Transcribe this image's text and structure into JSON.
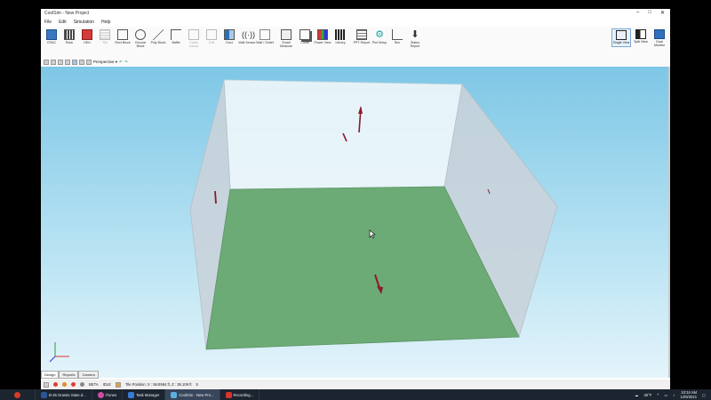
{
  "window": {
    "title": "CoolSim - New Project",
    "minimize": "–",
    "maximize": "□",
    "close": "✕"
  },
  "menu": [
    "File",
    "Edit",
    "Simulation",
    "Help"
  ],
  "ribbon": [
    {
      "label": "CRAC",
      "enabled": true
    },
    {
      "label": "Rack",
      "enabled": true
    },
    {
      "label": "HDU",
      "enabled": true
    },
    {
      "label": "Tile",
      "enabled": false
    },
    {
      "label": "Rect Block",
      "enabled": true
    },
    {
      "label": "Circular Block",
      "enabled": true
    },
    {
      "label": "Poly Block",
      "enabled": true
    },
    {
      "label": "Baffle",
      "enabled": true
    },
    {
      "label": "Cable Cutout",
      "enabled": false
    },
    {
      "label": "Grill",
      "enabled": false
    },
    {
      "label": "Duct",
      "enabled": true
    },
    {
      "label": "Wall Sensor",
      "enabled": true
    },
    {
      "label": "Wall / Outlet",
      "enabled": true
    },
    {
      "label": "Smart Measure",
      "enabled": true
    },
    {
      "label": "Clone",
      "enabled": true
    },
    {
      "label": "Power View",
      "enabled": true
    },
    {
      "label": "Library",
      "enabled": true
    },
    {
      "label": "PPT Report",
      "enabled": true
    },
    {
      "label": "Plot Setup",
      "enabled": true
    },
    {
      "label": "Run",
      "enabled": true
    },
    {
      "label": "Status Report",
      "enabled": true
    }
  ],
  "views": [
    {
      "label": "Single View",
      "active": true
    },
    {
      "label": "Split View",
      "active": false
    },
    {
      "label": "Dual Monitor",
      "active": false
    }
  ],
  "subtoolbar": {
    "perspective": "Perspective"
  },
  "bottom_tabs": [
    "Design",
    "Reports",
    "Camera"
  ],
  "status": {
    "beta": "BETA",
    "idle": "IDLE",
    "tile_position": "Tile Position: X : 58.8964 ft, Z : 36.109 ft",
    "count": "5"
  },
  "taskbar": {
    "items": [
      {
        "label": "B-26 Granite State.d...",
        "color": "#2b5797"
      },
      {
        "label": "iTunes",
        "color": "#d04da3"
      },
      {
        "label": "Task Manager",
        "color": "#3a7bd5"
      },
      {
        "label": "CoolSim - New Pro...",
        "color": "#5bb0e0"
      },
      {
        "label": "Recording...",
        "color": "#d9342b"
      }
    ],
    "weather": "30°F",
    "time": "10:34 AM",
    "date": "12/9/2021"
  },
  "colors": {
    "floor": "#6dab76",
    "arrow": "#8b1a2e",
    "sky": "#7ec7e6"
  }
}
